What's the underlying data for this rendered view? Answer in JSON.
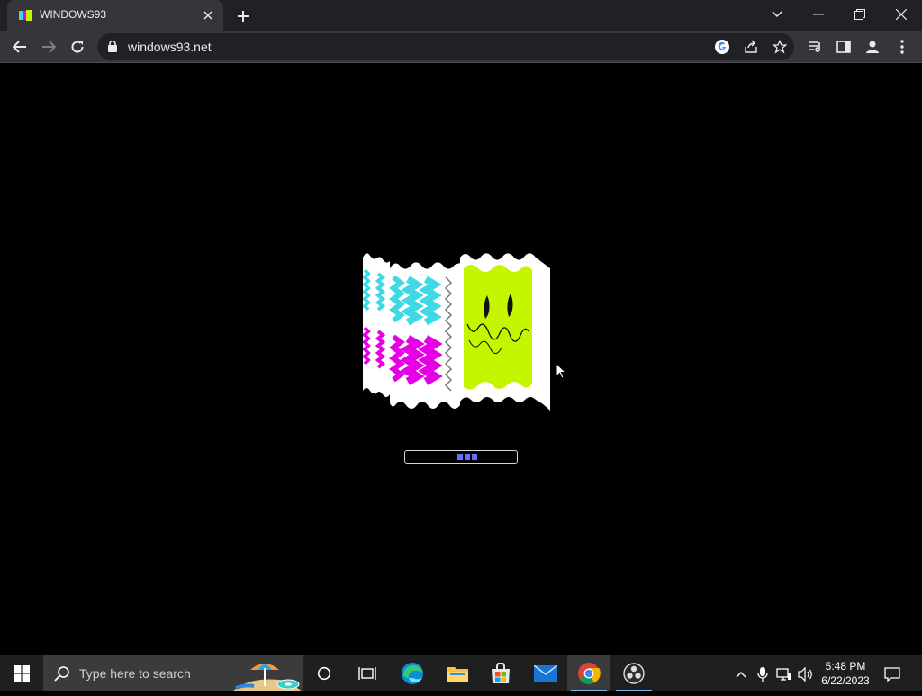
{
  "browser": {
    "tab_title": "WINDOWS93",
    "url": "windows93.net"
  },
  "page": {
    "loading_progress": 0.18,
    "logo": "windows93-boot-logo"
  },
  "taskbar": {
    "search_placeholder": "Type here to search",
    "time": "5:48 PM",
    "date": "6/22/2023"
  },
  "colors": {
    "background": "#000000",
    "tabstrip": "#202124",
    "toolbar": "#35363a",
    "logo_cyan": "#3fd9e6",
    "logo_magenta": "#e600e6",
    "logo_lime": "#c6f500",
    "progress_fill": "#6b6bff"
  }
}
